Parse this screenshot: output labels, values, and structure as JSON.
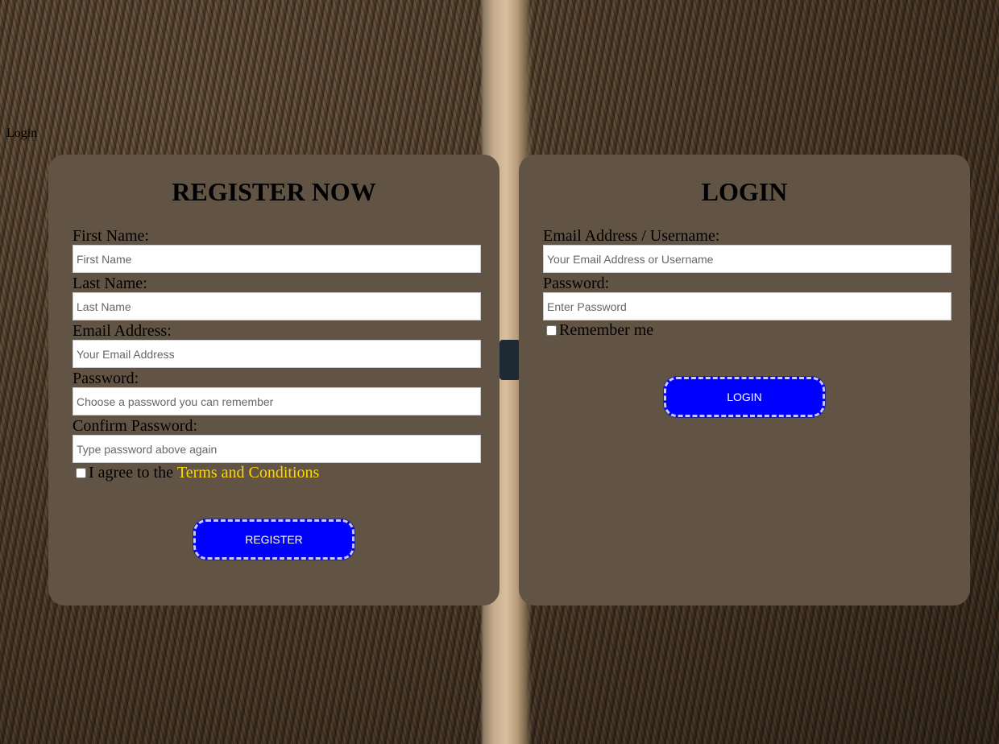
{
  "nav": {
    "login_link": "Login"
  },
  "register": {
    "title": "REGISTER NOW",
    "first_name": {
      "label": "First Name:",
      "placeholder": "First Name",
      "value": ""
    },
    "last_name": {
      "label": "Last Name:",
      "placeholder": "Last Name",
      "value": ""
    },
    "email": {
      "label": "Email Address:",
      "placeholder": "Your Email Address",
      "value": ""
    },
    "password": {
      "label": "Password:",
      "placeholder": "Choose a password you can remember",
      "value": ""
    },
    "confirm_password": {
      "label": "Confirm Password:",
      "placeholder": "Type password above again",
      "value": ""
    },
    "agree_text": "I agree to the",
    "terms_link": "Terms and Conditions",
    "agree_checked": false,
    "button_label": "REGISTER"
  },
  "login": {
    "title": "LOGIN",
    "email": {
      "label": "Email Address / Username:",
      "placeholder": "Your Email Address or Username",
      "value": ""
    },
    "password": {
      "label": "Password:",
      "placeholder": "Enter Password",
      "value": ""
    },
    "remember_text": "Remember me",
    "remember_checked": false,
    "button_label": "LOGIN"
  },
  "colors": {
    "card_background": "#625444",
    "button_background": "#0000ff",
    "terms_link": "#ffd700"
  }
}
